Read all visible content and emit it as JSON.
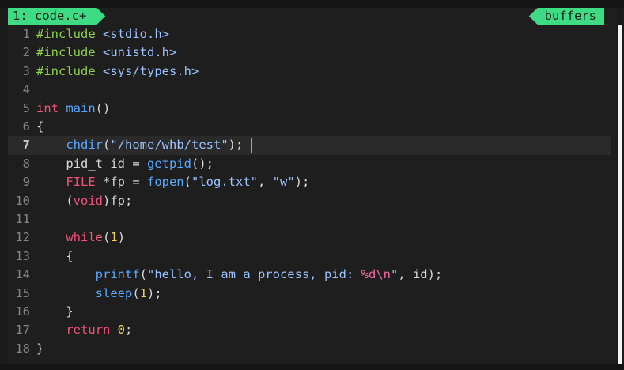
{
  "tabline": {
    "active_tab": "1: code.c+",
    "right_label": "buffers"
  },
  "colors": {
    "accent": "#3ddc84",
    "background": "#1e1e1e"
  },
  "editor": {
    "current_line": 7,
    "lines": [
      {
        "n": "1",
        "tokens": [
          {
            "t": "#include",
            "c": "k-green"
          },
          {
            "t": " "
          },
          {
            "t": "<stdio.h>",
            "c": "k-str"
          }
        ]
      },
      {
        "n": "2",
        "tokens": [
          {
            "t": "#include",
            "c": "k-green"
          },
          {
            "t": " "
          },
          {
            "t": "<unistd.h>",
            "c": "k-str"
          }
        ]
      },
      {
        "n": "3",
        "tokens": [
          {
            "t": "#include",
            "c": "k-green"
          },
          {
            "t": " "
          },
          {
            "t": "<sys/types.h>",
            "c": "k-str"
          }
        ]
      },
      {
        "n": "4",
        "tokens": []
      },
      {
        "n": "5",
        "tokens": [
          {
            "t": "int",
            "c": "k-red"
          },
          {
            "t": " "
          },
          {
            "t": "main",
            "c": "k-blue"
          },
          {
            "t": "()"
          }
        ]
      },
      {
        "n": "6",
        "tokens": [
          {
            "t": "{"
          }
        ]
      },
      {
        "n": "7",
        "tokens": [
          {
            "t": "    "
          },
          {
            "t": "chdir",
            "c": "k-blue"
          },
          {
            "t": "("
          },
          {
            "t": "\"/home/whb/test\"",
            "c": "k-str"
          },
          {
            "t": ");"
          }
        ],
        "cursor": true
      },
      {
        "n": "8",
        "tokens": [
          {
            "t": "    pid_t id = "
          },
          {
            "t": "getpid",
            "c": "k-blue"
          },
          {
            "t": "();"
          }
        ]
      },
      {
        "n": "9",
        "tokens": [
          {
            "t": "    "
          },
          {
            "t": "FILE",
            "c": "k-red"
          },
          {
            "t": " *fp = "
          },
          {
            "t": "fopen",
            "c": "k-blue"
          },
          {
            "t": "("
          },
          {
            "t": "\"log.txt\"",
            "c": "k-str"
          },
          {
            "t": ", "
          },
          {
            "t": "\"w\"",
            "c": "k-str"
          },
          {
            "t": ");"
          }
        ]
      },
      {
        "n": "10",
        "tokens": [
          {
            "t": "    ("
          },
          {
            "t": "void",
            "c": "k-red"
          },
          {
            "t": ")fp;"
          }
        ]
      },
      {
        "n": "11",
        "tokens": []
      },
      {
        "n": "12",
        "tokens": [
          {
            "t": "    "
          },
          {
            "t": "while",
            "c": "k-red"
          },
          {
            "t": "("
          },
          {
            "t": "1",
            "c": "k-num"
          },
          {
            "t": ")"
          }
        ]
      },
      {
        "n": "13",
        "tokens": [
          {
            "t": "    {"
          }
        ]
      },
      {
        "n": "14",
        "tokens": [
          {
            "t": "        "
          },
          {
            "t": "printf",
            "c": "k-blue"
          },
          {
            "t": "("
          },
          {
            "t": "\"hello, I am a process, pid: ",
            "c": "k-str"
          },
          {
            "t": "%d\\n",
            "c": "k-fmt"
          },
          {
            "t": "\"",
            "c": "k-str"
          },
          {
            "t": ", id);"
          }
        ]
      },
      {
        "n": "15",
        "tokens": [
          {
            "t": "        "
          },
          {
            "t": "sleep",
            "c": "k-blue"
          },
          {
            "t": "("
          },
          {
            "t": "1",
            "c": "k-num"
          },
          {
            "t": ");"
          }
        ]
      },
      {
        "n": "16",
        "tokens": [
          {
            "t": "    }"
          }
        ]
      },
      {
        "n": "17",
        "tokens": [
          {
            "t": "    "
          },
          {
            "t": "return",
            "c": "k-red"
          },
          {
            "t": " "
          },
          {
            "t": "0",
            "c": "k-num"
          },
          {
            "t": ";"
          }
        ]
      },
      {
        "n": "18",
        "tokens": [
          {
            "t": "}"
          }
        ]
      }
    ]
  }
}
